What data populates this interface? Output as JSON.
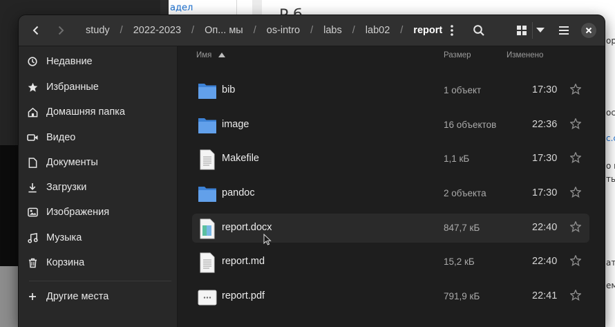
{
  "background": {
    "top_link": "адел",
    "heading": "Р б",
    "side_text": [
      "ори",
      "ост",
      "с.со",
      "о и",
      "ать",
      "ем"
    ]
  },
  "header": {
    "breadcrumbs": [
      "study",
      "2022-2023",
      "Оп... мы",
      "os-intro",
      "labs",
      "lab02",
      "report"
    ]
  },
  "sidebar": {
    "items": [
      {
        "label": "Недавние",
        "icon": "clock-icon"
      },
      {
        "label": "Избранные",
        "icon": "star-icon"
      },
      {
        "label": "Домашняя папка",
        "icon": "home-icon"
      },
      {
        "label": "Видео",
        "icon": "video-icon"
      },
      {
        "label": "Документы",
        "icon": "document-icon"
      },
      {
        "label": "Загрузки",
        "icon": "download-icon"
      },
      {
        "label": "Изображения",
        "icon": "image-icon"
      },
      {
        "label": "Музыка",
        "icon": "music-icon"
      },
      {
        "label": "Корзина",
        "icon": "trash-icon"
      }
    ],
    "other_places": "Другие места"
  },
  "columns": {
    "name": "Имя",
    "size": "Размер",
    "modified": "Изменено"
  },
  "files": [
    {
      "name": "bib",
      "size": "1 объект",
      "time": "17:30",
      "type": "folder"
    },
    {
      "name": "image",
      "size": "16 объектов",
      "time": "22:36",
      "type": "folder"
    },
    {
      "name": "Makefile",
      "size": "1,1 кБ",
      "time": "17:30",
      "type": "text"
    },
    {
      "name": "pandoc",
      "size": "2 объекта",
      "time": "17:30",
      "type": "folder"
    },
    {
      "name": "report.docx",
      "size": "847,7 кБ",
      "time": "22:40",
      "type": "docx"
    },
    {
      "name": "report.md",
      "size": "15,2 кБ",
      "time": "22:40",
      "type": "text"
    },
    {
      "name": "report.pdf",
      "size": "791,9 кБ",
      "time": "22:41",
      "type": "pdf"
    }
  ],
  "colors": {
    "folder": "#62a0ea",
    "accent": "#3584e4",
    "window_bg": "#1e1e1e"
  }
}
